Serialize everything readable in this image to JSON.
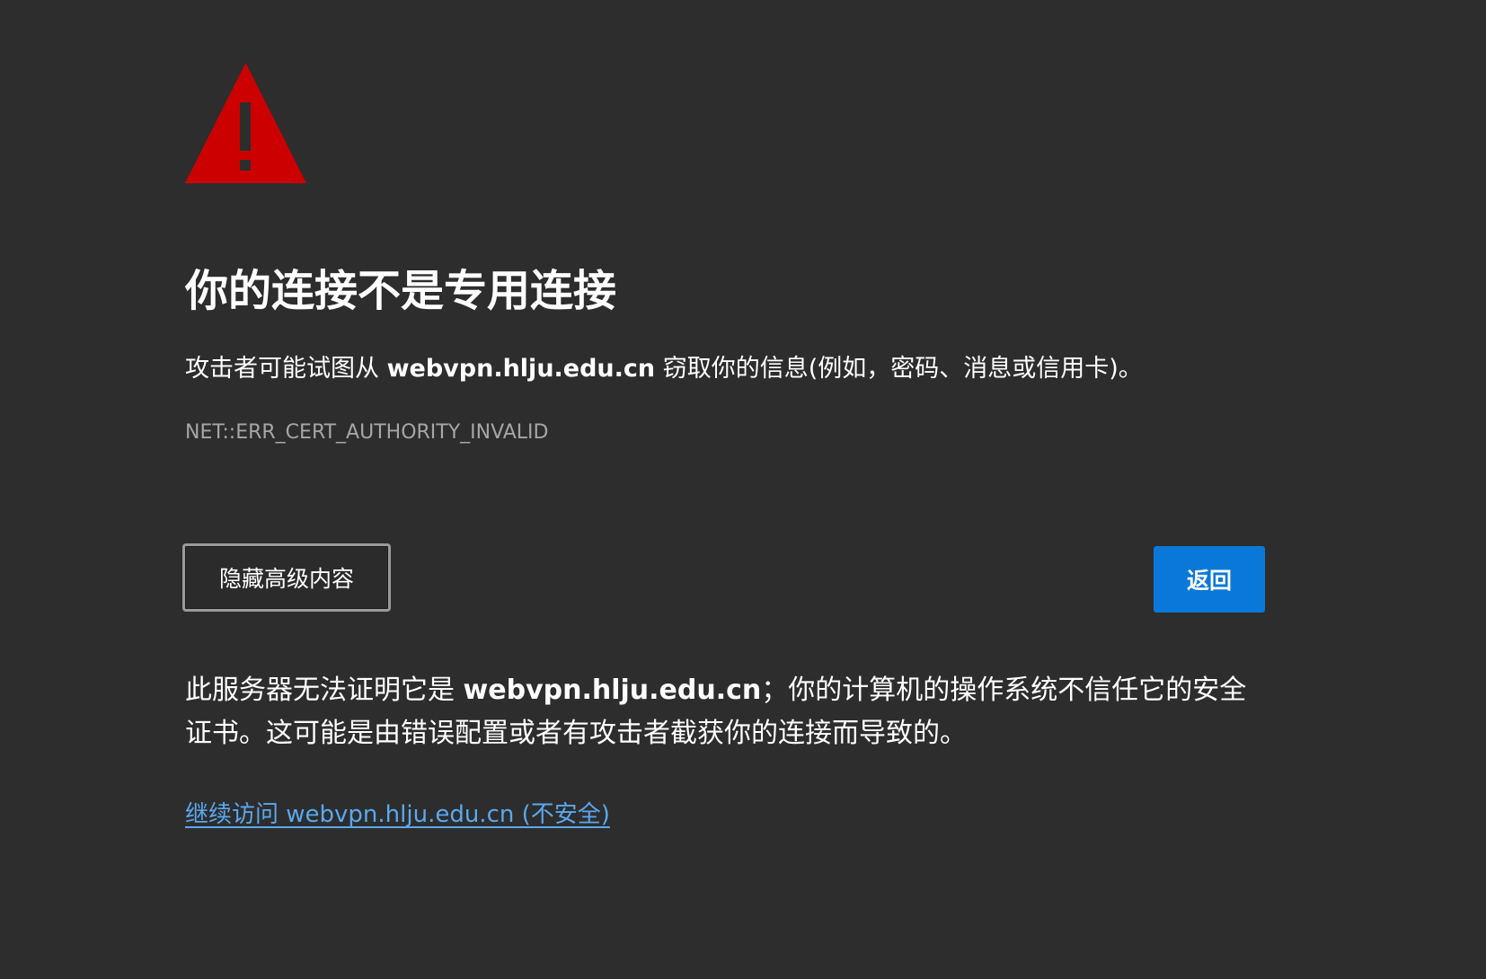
{
  "page": {
    "title": "你的连接不是专用连接",
    "intro_before": "攻击者可能试图从 ",
    "intro_host": "webvpn.hlju.edu.cn",
    "intro_after": " 窃取你的信息(例如，密码、消息或信用卡)。",
    "error_code": "NET::ERR_CERT_AUTHORITY_INVALID",
    "details_before": "此服务器无法证明它是 ",
    "details_host": "webvpn.hlju.edu.cn",
    "details_after": "；你的计算机的操作系统不信任它的安全证书。这可能是由错误配置或者有攻击者截获你的连接而导致的。",
    "proceed_link": "继续访问 webvpn.hlju.edu.cn (不安全)"
  },
  "buttons": {
    "advanced_label": "隐藏高级内容",
    "back_label": "返回"
  },
  "icons": {
    "warning": "warning-triangle-icon"
  },
  "colors": {
    "background": "#2d2d2d",
    "warning": "#cc0000",
    "primary_button": "#0a78d8",
    "link": "#5aa8ee",
    "error_code_text": "#a6a6a6"
  }
}
